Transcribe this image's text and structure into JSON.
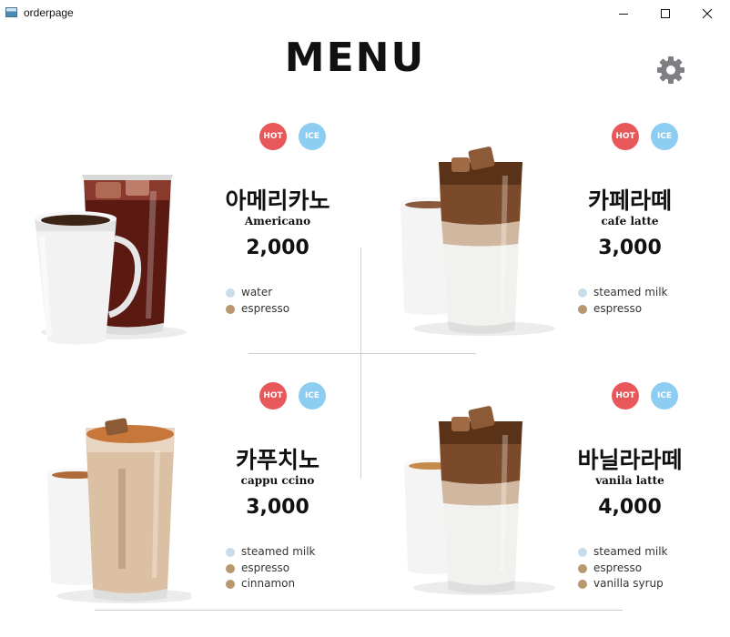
{
  "window": {
    "title": "orderpage"
  },
  "header": {
    "title": "MENU",
    "settings_icon": "gear-icon"
  },
  "colors": {
    "hot": "#e8585a",
    "ice": "#8ecdf2",
    "water": "#c8dde9",
    "espresso": "#b9976f",
    "milk": "#c8dde9",
    "cinnamon": "#b9976f",
    "vanilla": "#b9976f"
  },
  "menu": [
    {
      "name_ko": "아메리카노",
      "name_en": "Americano",
      "price": "2,000",
      "hot_label": "HOT",
      "ice_label": "ICE",
      "ingredients": [
        {
          "label": "water",
          "color": "#c8dde9"
        },
        {
          "label": "espresso",
          "color": "#b9976f"
        }
      ]
    },
    {
      "name_ko": "카페라떼",
      "name_en": "cafe latte",
      "price": "3,000",
      "hot_label": "HOT",
      "ice_label": "ICE",
      "ingredients": [
        {
          "label": "steamed milk",
          "color": "#c8dde9"
        },
        {
          "label": "espresso",
          "color": "#b9976f"
        }
      ]
    },
    {
      "name_ko": "카푸치노",
      "name_en": "cappu ccino",
      "price": "3,000",
      "hot_label": "HOT",
      "ice_label": "ICE",
      "ingredients": [
        {
          "label": "steamed milk",
          "color": "#c8dde9"
        },
        {
          "label": "espresso",
          "color": "#b9976f"
        },
        {
          "label": "cinnamon",
          "color": "#b9976f"
        }
      ]
    },
    {
      "name_ko": "바닐라라떼",
      "name_en": "vanila latte",
      "price": "4,000",
      "hot_label": "HOT",
      "ice_label": "ICE",
      "ingredients": [
        {
          "label": "steamed milk",
          "color": "#c8dde9"
        },
        {
          "label": "espresso",
          "color": "#b9976f"
        },
        {
          "label": "vanilla syrup",
          "color": "#b9976f"
        }
      ]
    }
  ]
}
